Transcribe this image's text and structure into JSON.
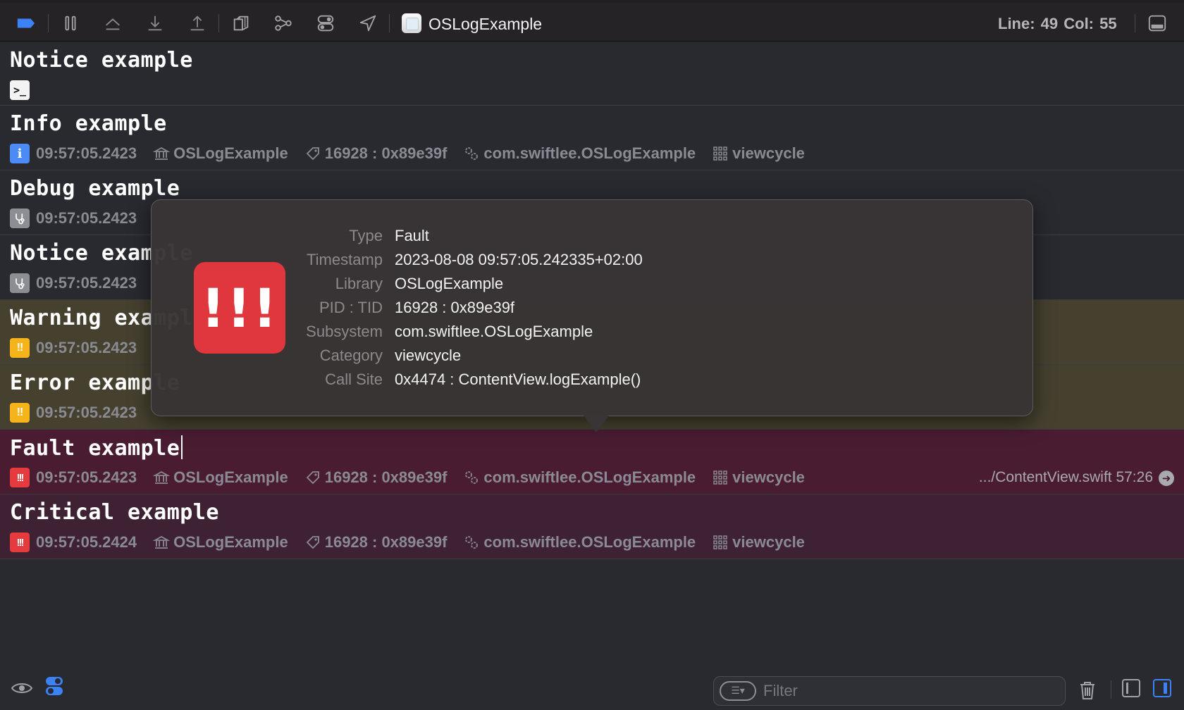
{
  "toolbar": {
    "target_name": "OSLogExample",
    "line_col": "Line: 49  Col: 55"
  },
  "logs": [
    {
      "message": "Notice example"
    },
    {
      "message": "Info example",
      "time": "09:57:05.2423",
      "library": "OSLogExample",
      "pid_tid": "16928 : 0x89e39f",
      "subsystem": "com.swiftlee.OSLogExample",
      "category": "viewcycle"
    },
    {
      "message": "Debug example",
      "time": "09:57:05.2423"
    },
    {
      "message": "Notice example",
      "time": "09:57:05.2423"
    },
    {
      "message": "Warning example",
      "time": "09:57:05.2423"
    },
    {
      "message": "Error example",
      "time": "09:57:05.2423"
    },
    {
      "message": "Fault example",
      "time": "09:57:05.2423",
      "library": "OSLogExample",
      "pid_tid": "16928 : 0x89e39f",
      "subsystem": "com.swiftlee.OSLogExample",
      "category": "viewcycle",
      "callsite": ".../ContentView.swift 57:26"
    },
    {
      "message": "Critical example",
      "time": "09:57:05.2424",
      "library": "OSLogExample",
      "pid_tid": "16928 : 0x89e39f",
      "subsystem": "com.swiftlee.OSLogExample",
      "category": "viewcycle"
    }
  ],
  "badges": {
    "info": "i",
    "warn": "!!",
    "fault": "!!!",
    "terminal": ">_"
  },
  "popover": {
    "icon_text": "!!!",
    "labels": [
      "Type",
      "Timestamp",
      "Library",
      "PID : TID",
      "Subsystem",
      "Category",
      "Call Site"
    ],
    "values": [
      "Fault",
      "2023-08-08 09:57:05.242335+02:00",
      "OSLogExample",
      "16928 : 0x89e39f",
      "com.swiftlee.OSLogExample",
      "viewcycle",
      "0x4474 : ContentView.logExample()"
    ]
  },
  "filter": {
    "placeholder": "Filter"
  },
  "colors": {
    "info": "#4c8bf5",
    "warning": "#f5b51a",
    "fault": "#e53a3e",
    "accent": "#3b82f6"
  },
  "icons": [
    "breakpoints-toggle-icon",
    "pause-icon",
    "step-over-icon",
    "step-into-icon",
    "step-out-icon",
    "view-hierarchy-icon",
    "memory-graph-icon",
    "environment-overrides-icon",
    "simulate-location-icon",
    "hide-debug-area-icon",
    "library-icon",
    "tag-icon",
    "subsystem-gears-icon",
    "category-grid-icon",
    "eye-icon",
    "trash-icon"
  ]
}
